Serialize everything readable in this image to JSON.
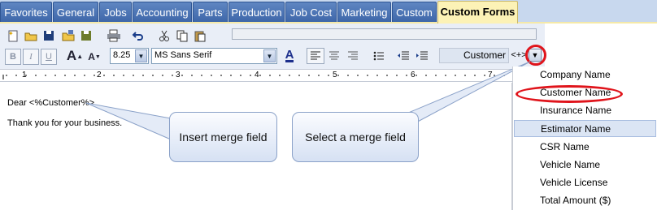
{
  "tabs": [
    {
      "label": "Favorites"
    },
    {
      "label": "General"
    },
    {
      "label": "Jobs"
    },
    {
      "label": "Accounting"
    },
    {
      "label": "Parts"
    },
    {
      "label": "Production"
    },
    {
      "label": "Job Cost"
    },
    {
      "label": "Marketing"
    },
    {
      "label": "Custom"
    },
    {
      "label": "Custom Forms",
      "active": true
    }
  ],
  "toolbar": {
    "font_size": "8.25",
    "font_name": "MS Sans Serif",
    "bold_label": "B",
    "italic_label": "I",
    "underline_label": "U",
    "merge_field_value": "Customer",
    "merge_insert_label": "<+>"
  },
  "ruler": {
    "numbers": [
      "1",
      "2",
      "3",
      "4",
      "5",
      "6",
      "7"
    ]
  },
  "document": {
    "line1": "Dear <%Customer%>",
    "line2": "Thank you for your business."
  },
  "callouts": {
    "insert": "Insert merge field",
    "select": "Select a merge field"
  },
  "merge_fields": [
    "Company Name",
    "Customer Name",
    "Insurance Name",
    "Estimator Name",
    "CSR Name",
    "Vehicle Name",
    "Vehicle License",
    "Total Amount ($)"
  ],
  "highlighted_field": "Estimator Name",
  "colors": {
    "tab_blue": "#4a72b2",
    "tab_active": "#fcf2b6",
    "highlight_red": "#e0141b",
    "callout_border": "#8aa1c8"
  }
}
